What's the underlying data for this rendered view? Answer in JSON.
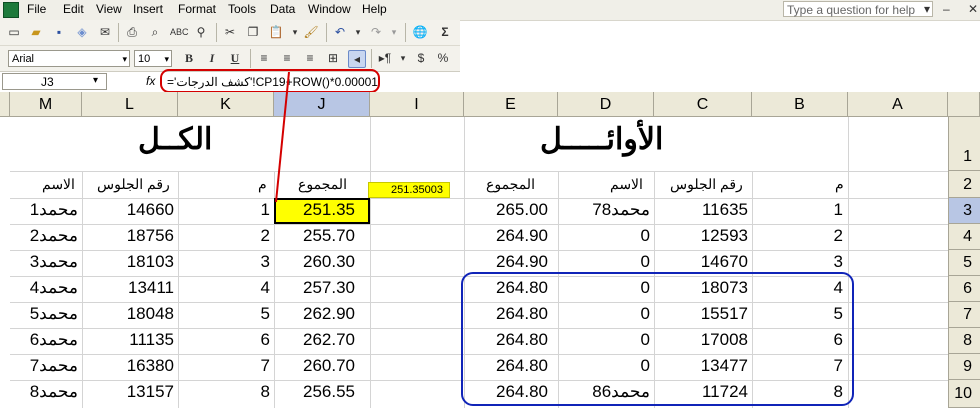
{
  "menubar": {
    "items": [
      "File",
      "Edit",
      "View",
      "Insert",
      "Format",
      "Tools",
      "Data",
      "Window",
      "Help"
    ],
    "help_box_placeholder": "Type a question for help"
  },
  "toolbar": {
    "font_name": "Arial",
    "font_size": "10",
    "bold": "B",
    "italic": "I",
    "underline": "U",
    "currency": "$",
    "percent": "%",
    "sum": "Σ"
  },
  "formula_bar": {
    "name_box": "J3",
    "fx": "fx",
    "formula": "='كشف الدرجات'!CP19+ROW()*0.00001"
  },
  "columns": {
    "left_group": [
      "M",
      "L",
      "K",
      "J",
      "I"
    ],
    "right_group": [
      "E",
      "D",
      "C",
      "B",
      "A"
    ]
  },
  "rows": [
    "1",
    "2",
    "3",
    "4",
    "5",
    "6",
    "7",
    "8",
    "9",
    "10"
  ],
  "sheet": {
    "title_all": "الكــل",
    "title_first": "الأوائـــــل",
    "tooltip_value": "251.35003",
    "left_headers": {
      "name": "الاسم",
      "seat": "رقم الجلوس",
      "num": "م",
      "total": "المجموع"
    },
    "right_headers": {
      "total": "المجموع",
      "name": "الاسم",
      "seat": "رقم الجلوس",
      "num": "م"
    },
    "left_table": [
      {
        "name": "محمد1",
        "seat": "14660",
        "num": "1",
        "total": "251.35"
      },
      {
        "name": "محمد2",
        "seat": "18756",
        "num": "2",
        "total": "255.70"
      },
      {
        "name": "محمد3",
        "seat": "18103",
        "num": "3",
        "total": "260.30"
      },
      {
        "name": "محمد4",
        "seat": "13411",
        "num": "4",
        "total": "257.30"
      },
      {
        "name": "محمد5",
        "seat": "18048",
        "num": "5",
        "total": "262.90"
      },
      {
        "name": "محمد6",
        "seat": "11135",
        "num": "6",
        "total": "262.70"
      },
      {
        "name": "محمد7",
        "seat": "16380",
        "num": "7",
        "total": "260.70"
      },
      {
        "name": "محمد8",
        "seat": "13157",
        "num": "8",
        "total": "256.55"
      }
    ],
    "right_table": [
      {
        "total": "265.00",
        "name": "محمد78",
        "seat": "11635",
        "num": "1"
      },
      {
        "total": "264.90",
        "name": "0",
        "seat": "12593",
        "num": "2"
      },
      {
        "total": "264.90",
        "name": "0",
        "seat": "14670",
        "num": "3"
      },
      {
        "total": "264.80",
        "name": "0",
        "seat": "18073",
        "num": "4"
      },
      {
        "total": "264.80",
        "name": "0",
        "seat": "15517",
        "num": "5"
      },
      {
        "total": "264.80",
        "name": "0",
        "seat": "17008",
        "num": "6"
      },
      {
        "total": "264.80",
        "name": "0",
        "seat": "13477",
        "num": "7"
      },
      {
        "total": "264.80",
        "name": "محمد86",
        "seat": "11724",
        "num": "8"
      }
    ]
  },
  "colors": {
    "selected_cell_fill": "#ffff00",
    "annotation_red": "#d40000",
    "annotation_blue": "#1024b8",
    "tooltip_fill": "#ffff00"
  }
}
